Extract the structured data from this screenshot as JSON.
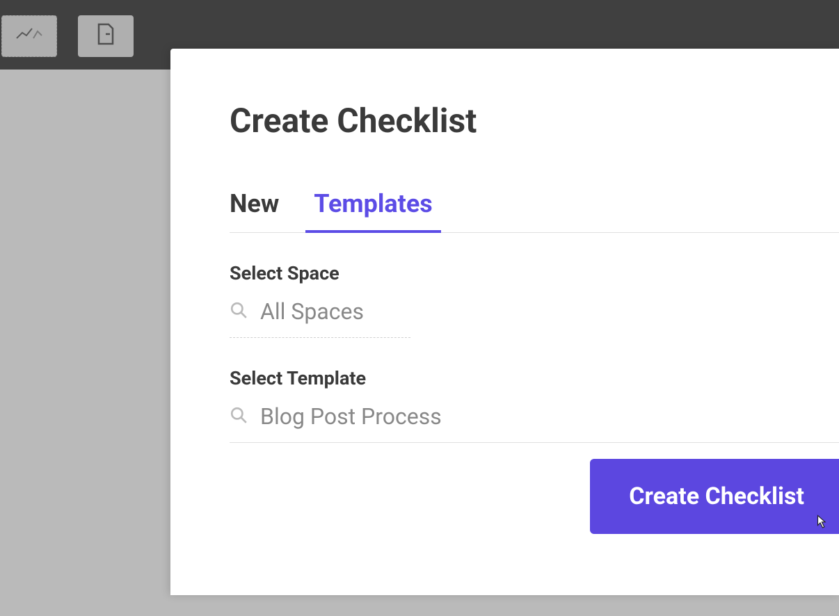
{
  "modal": {
    "title": "Create Checklist",
    "tabs": [
      {
        "label": "New",
        "active": false
      },
      {
        "label": "Templates",
        "active": true
      }
    ],
    "space": {
      "label": "Select Space",
      "value": "All Spaces"
    },
    "template": {
      "label": "Select Template",
      "value": "Blog Post Process"
    },
    "create_button": "Create Checklist"
  },
  "icons": {
    "search": "search-icon",
    "cursor": "cursor-pointer-icon",
    "toolbar_chart": "chart-icon",
    "toolbar_doc": "document-icon"
  }
}
